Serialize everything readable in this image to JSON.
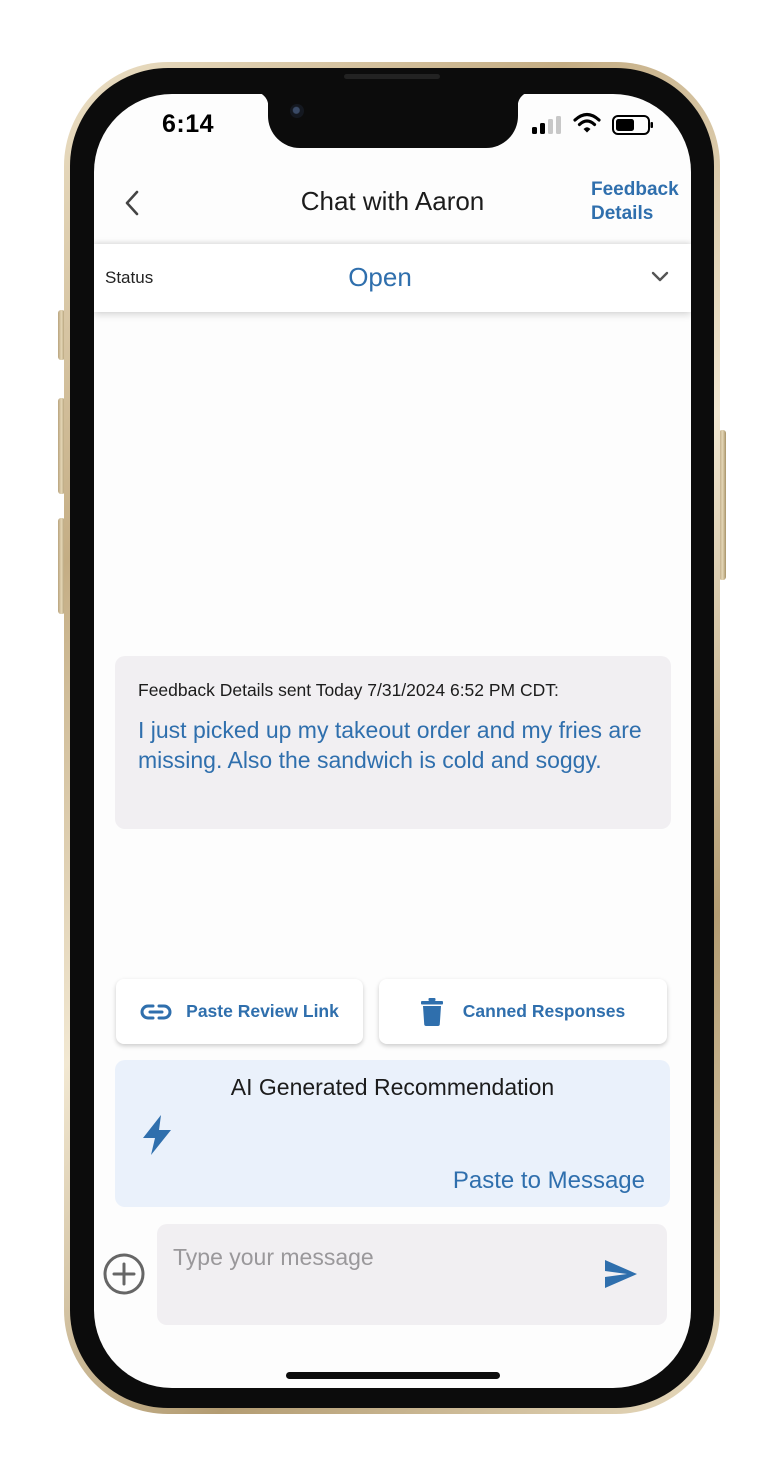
{
  "status_bar": {
    "time": "6:14"
  },
  "header": {
    "title": "Chat with Aaron",
    "feedback_link_line1": "Feedback",
    "feedback_link_line2": "Details"
  },
  "status": {
    "label": "Status",
    "value": "Open"
  },
  "message": {
    "meta": "Feedback Details sent Today 7/31/2024 6:52 PM CDT:",
    "text": "I just picked up my takeout order and my fries are missing. Also the sandwich is cold and soggy."
  },
  "actions": {
    "paste_review_link": "Paste Review Link",
    "canned_responses": "Canned Responses"
  },
  "ai_recommendation": {
    "title": "AI Generated Recommendation",
    "paste_label": "Paste to Message"
  },
  "composer": {
    "placeholder": "Type your message",
    "value": ""
  },
  "icons": {
    "back": "chevron-left-icon",
    "dropdown": "chevron-down-icon",
    "link": "link-icon",
    "trash": "trash-icon",
    "bolt": "bolt-icon",
    "add": "add-circle-icon",
    "send": "send-icon"
  },
  "colors": {
    "accent": "#2f6fad",
    "bubble_bg": "#f1eff2",
    "ai_card_bg": "#eaf1fb",
    "screen_bg": "#fdfdfd"
  }
}
